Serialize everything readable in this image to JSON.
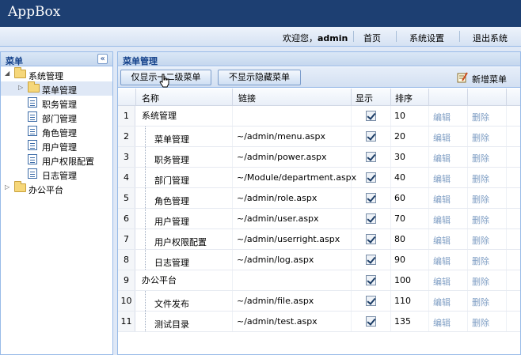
{
  "app": {
    "title": "AppBox"
  },
  "topbar": {
    "welcome_prefix": "欢迎您，",
    "user": "admin",
    "links": [
      "首页",
      "系统设置",
      "退出系统"
    ]
  },
  "left_panel": {
    "title": "菜单",
    "collapse_icon": "«",
    "tree": [
      {
        "label": "系统管理",
        "type": "folder",
        "expanded": true
      },
      {
        "label": "菜单管理",
        "type": "folder",
        "selected": true
      },
      {
        "label": "职务管理",
        "type": "leaf"
      },
      {
        "label": "部门管理",
        "type": "leaf"
      },
      {
        "label": "角色管理",
        "type": "leaf"
      },
      {
        "label": "用户管理",
        "type": "leaf"
      },
      {
        "label": "用户权限配置",
        "type": "leaf"
      },
      {
        "label": "日志管理",
        "type": "leaf"
      },
      {
        "label": "办公平台",
        "type": "folder",
        "expanded": false
      }
    ]
  },
  "right_panel": {
    "title": "菜单管理",
    "toolbar": {
      "btn_show_level2": "仅显示一二级菜单",
      "btn_hide_hidden": "不显示隐藏菜单",
      "add_label": "新增菜单"
    },
    "columns": {
      "name": "名称",
      "link": "链接",
      "show": "显示",
      "order": "排序"
    },
    "rows": [
      {
        "num": "1",
        "name": "系统管理",
        "link": "",
        "show": true,
        "order": "10",
        "edit": "编辑",
        "delete": "删除",
        "level": 1
      },
      {
        "num": "2",
        "name": "菜单管理",
        "link": "~/admin/menu.aspx",
        "show": true,
        "order": "20",
        "edit": "编辑",
        "delete": "删除",
        "level": 2
      },
      {
        "num": "3",
        "name": "职务管理",
        "link": "~/admin/power.aspx",
        "show": true,
        "order": "30",
        "edit": "编辑",
        "delete": "删除",
        "level": 2
      },
      {
        "num": "4",
        "name": "部门管理",
        "link": "~/Module/department.aspx",
        "show": true,
        "order": "40",
        "edit": "编辑",
        "delete": "删除",
        "level": 2
      },
      {
        "num": "5",
        "name": "角色管理",
        "link": "~/admin/role.aspx",
        "show": true,
        "order": "60",
        "edit": "编辑",
        "delete": "删除",
        "level": 2
      },
      {
        "num": "6",
        "name": "用户管理",
        "link": "~/admin/user.aspx",
        "show": true,
        "order": "70",
        "edit": "编辑",
        "delete": "删除",
        "level": 2
      },
      {
        "num": "7",
        "name": "用户权限配置",
        "link": "~/admin/userright.aspx",
        "show": true,
        "order": "80",
        "edit": "编辑",
        "delete": "删除",
        "level": 2
      },
      {
        "num": "8",
        "name": "日志管理",
        "link": "~/admin/log.aspx",
        "show": true,
        "order": "90",
        "edit": "编辑",
        "delete": "删除",
        "level": 2
      },
      {
        "num": "9",
        "name": "办公平台",
        "link": "",
        "show": true,
        "order": "100",
        "edit": "编辑",
        "delete": "删除",
        "level": 1
      },
      {
        "num": "10",
        "name": "文件发布",
        "link": "~/admin/file.aspx",
        "show": true,
        "order": "110",
        "edit": "编辑",
        "delete": "删除",
        "level": 2
      },
      {
        "num": "11",
        "name": "测试目录",
        "link": "~/admin/test.aspx",
        "show": true,
        "order": "135",
        "edit": "编辑",
        "delete": "删除",
        "level": 2
      }
    ]
  },
  "colors": {
    "header_bg": "#1d3f72",
    "panel_border": "#99bbe8",
    "action_link": "#7f9ec4"
  }
}
